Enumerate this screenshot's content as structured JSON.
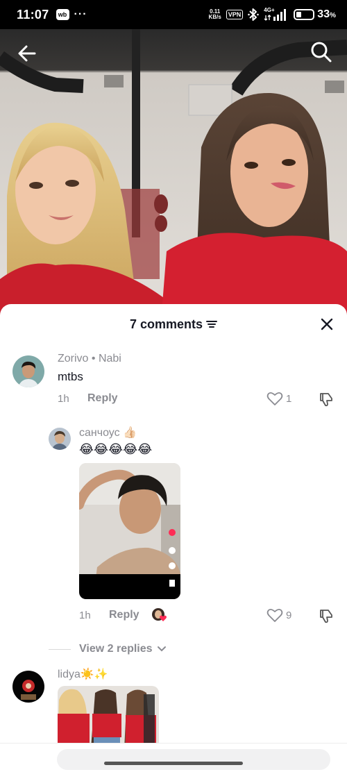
{
  "status_bar": {
    "time": "11:07",
    "app_badge": "wb",
    "dots": "···",
    "net_speed_value": "0.11",
    "net_speed_unit": "KB/s",
    "vpn": "VPN",
    "signal_label": "4G+",
    "battery_percent": "33",
    "battery_percent_sign": "%",
    "battery_level": 0.33
  },
  "video": {
    "back_icon": "arrow-left-icon",
    "search_icon": "search-icon"
  },
  "comments_sheet": {
    "title": "7 comments",
    "sort_icon": "sort-icon",
    "close_icon": "close-icon",
    "comments": [
      {
        "author": "Zorivo • Nabi",
        "text": "mtbs",
        "time": "1h",
        "reply_label": "Reply",
        "likes": "1"
      },
      {
        "author": "санчоус 👍🏻",
        "text": "😂😂😂😂😂",
        "time": "1h",
        "reply_label": "Reply",
        "likes": "9",
        "view_replies": "View 2 replies"
      },
      {
        "author": "lidya☀️✨"
      }
    ]
  },
  "colors": {
    "accent_like": "#fe2c55",
    "text_primary": "#161823",
    "text_secondary": "#8a8b91"
  }
}
